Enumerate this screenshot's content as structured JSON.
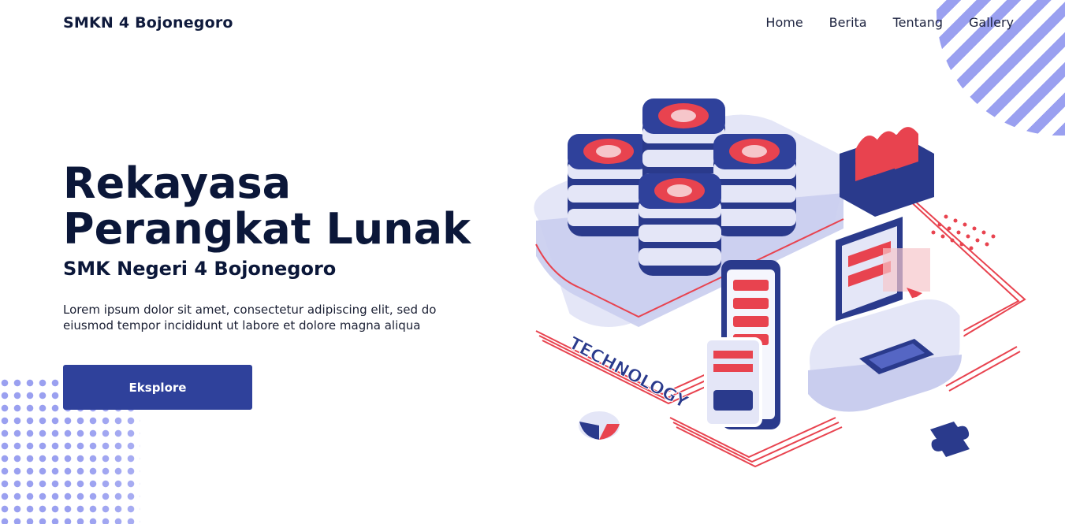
{
  "nav": {
    "brand": "SMKN 4 Bojonegoro",
    "items": [
      {
        "label": "Home"
      },
      {
        "label": "Berita"
      },
      {
        "label": "Tentang"
      },
      {
        "label": "Gallery"
      }
    ]
  },
  "hero": {
    "title": "Rekayasa Perangkat Lunak",
    "subtitle": "SMK Negeri 4 Bojonegoro",
    "description": "Lorem ipsum dolor sit amet, consectetur adipiscing elit, sed do eiusmod tempor incididunt ut labore et dolore magna aliqua",
    "cta_label": "Eksplore"
  },
  "illustration": {
    "sign_text": "TECHNOLOGY"
  },
  "colors": {
    "primary": "#2f419b",
    "heading": "#0b1739",
    "decor": "#9aa0f0",
    "accent_red": "#e8434f",
    "navy": "#2a3a8c"
  }
}
